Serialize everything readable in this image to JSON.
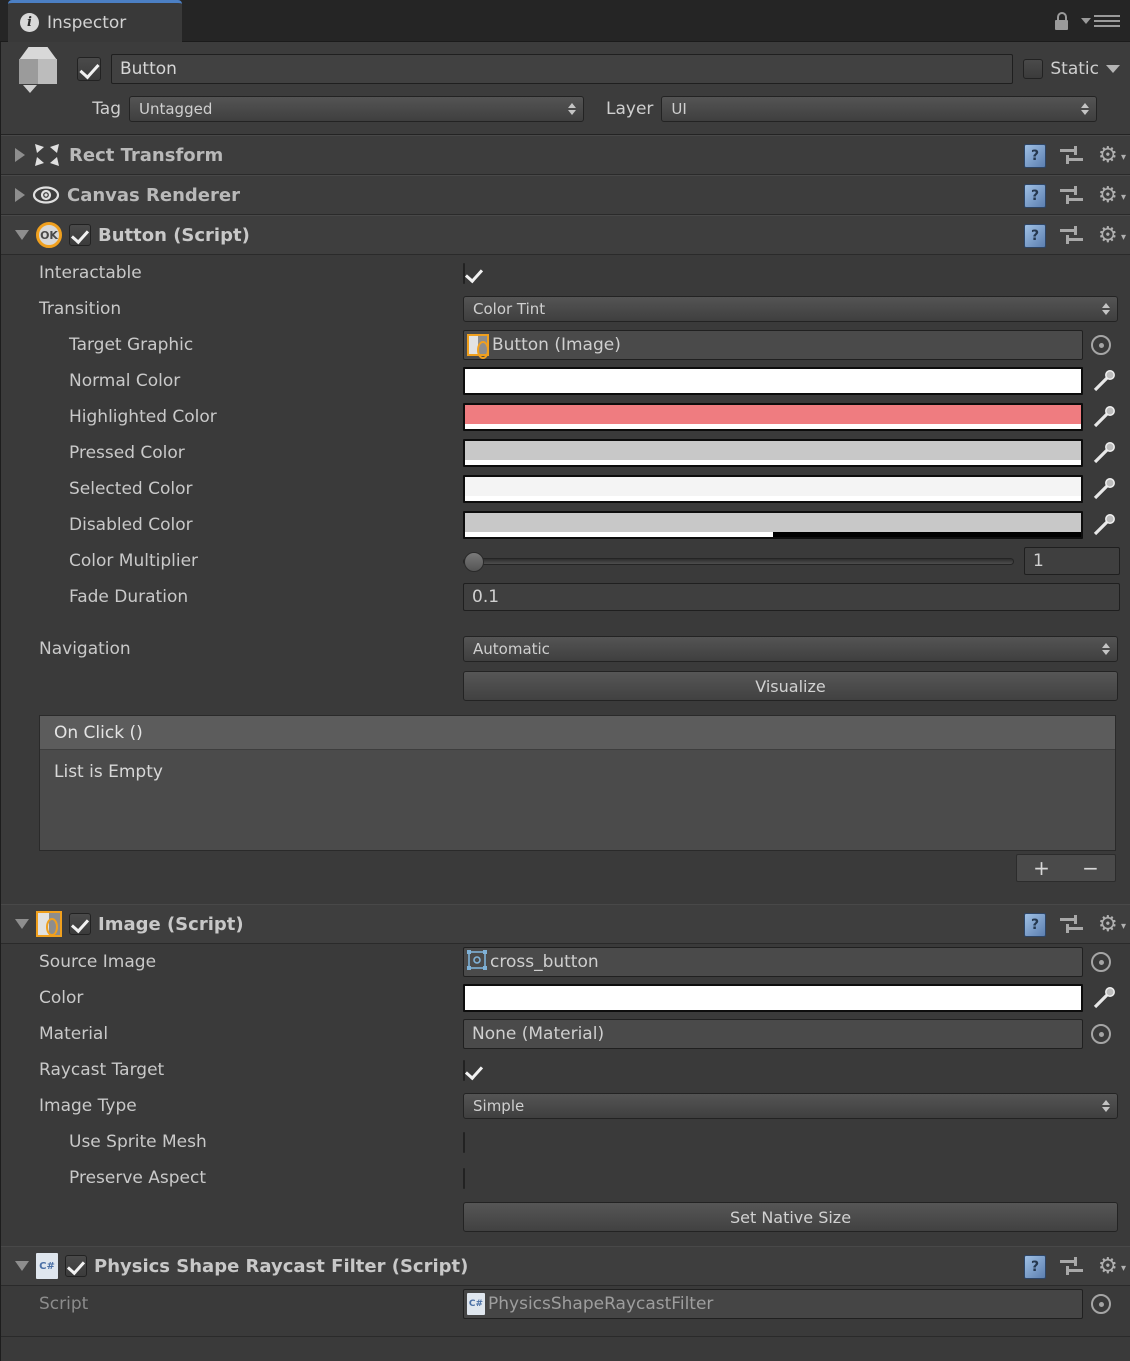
{
  "window": {
    "tab_label": "Inspector",
    "tab_icon": "info-icon",
    "lock_icon": "lock-icon",
    "menu_icon": "hamburger-menu-icon"
  },
  "gameobject": {
    "icon": "cube-icon",
    "enabled": true,
    "name": "Button",
    "static_label": "Static",
    "static_checked": false,
    "tag_label": "Tag",
    "tag_value": "Untagged",
    "layer_label": "Layer",
    "layer_value": "UI"
  },
  "header_icons": {
    "help": "help-book-icon",
    "preset": "preset-slider-icon",
    "gear": "gear-icon"
  },
  "components": [
    {
      "name": "Rect Transform",
      "icon": "rect-transform-icon",
      "expanded": false
    },
    {
      "name": "Canvas Renderer",
      "icon": "canvas-renderer-eye-icon",
      "expanded": false
    }
  ],
  "button_script": {
    "title": "Button (Script)",
    "icon": "ok-script-icon",
    "enabled": true,
    "expanded": true,
    "rows": {
      "interactable": {
        "label": "Interactable",
        "checked": true
      },
      "transition": {
        "label": "Transition",
        "value": "Color Tint"
      },
      "target_graphic": {
        "label": "Target Graphic",
        "value": "Button (Image)",
        "icon": "sprite-icon"
      },
      "normal_color": {
        "label": "Normal Color",
        "color": "#ffffff",
        "alpha": 1.0
      },
      "highlighted_color": {
        "label": "Highlighted Color",
        "color": "#ef7c80",
        "alpha": 1.0
      },
      "pressed_color": {
        "label": "Pressed Color",
        "color": "#c8c8c8",
        "alpha": 1.0
      },
      "selected_color": {
        "label": "Selected Color",
        "color": "#f4f4f4",
        "alpha": 1.0
      },
      "disabled_color": {
        "label": "Disabled Color",
        "color": "#c8c8c8",
        "alpha": 0.5
      },
      "color_multiplier": {
        "label": "Color Multiplier",
        "value": "1",
        "slider_pos": 0
      },
      "fade_duration": {
        "label": "Fade Duration",
        "value": "0.1"
      },
      "navigation": {
        "label": "Navigation",
        "value": "Automatic"
      },
      "visualize": {
        "label": "Visualize"
      }
    },
    "on_click": {
      "header": "On Click ()",
      "empty_text": "List is Empty",
      "add_label": "+",
      "remove_label": "−"
    }
  },
  "image_script": {
    "title": "Image (Script)",
    "icon": "sprite-script-icon",
    "enabled": true,
    "expanded": true,
    "rows": {
      "source_image": {
        "label": "Source Image",
        "value": "cross_button",
        "icon": "sprite-thumb-icon"
      },
      "color": {
        "label": "Color",
        "color": "#ffffff",
        "alpha": 1.0
      },
      "material": {
        "label": "Material",
        "value": "None (Material)"
      },
      "raycast_target": {
        "label": "Raycast Target",
        "checked": true
      },
      "image_type": {
        "label": "Image Type",
        "value": "Simple"
      },
      "use_sprite_mesh": {
        "label": "Use Sprite Mesh",
        "checked": false
      },
      "preserve_aspect": {
        "label": "Preserve Aspect",
        "checked": false
      },
      "set_native_size": {
        "label": "Set Native Size"
      }
    }
  },
  "physics_filter": {
    "title": "Physics Shape Raycast Filter (Script)",
    "icon": "csharp-script-icon",
    "enabled": true,
    "expanded": true,
    "script_label": "Script",
    "script_value": "PhysicsShapeRaycastFilter"
  },
  "colors": {
    "accent_tab": "#4b7fc4",
    "script_orange": "#f0a01e",
    "panel_bg": "#3a3a3a",
    "header_bg": "#3e3e3e"
  }
}
